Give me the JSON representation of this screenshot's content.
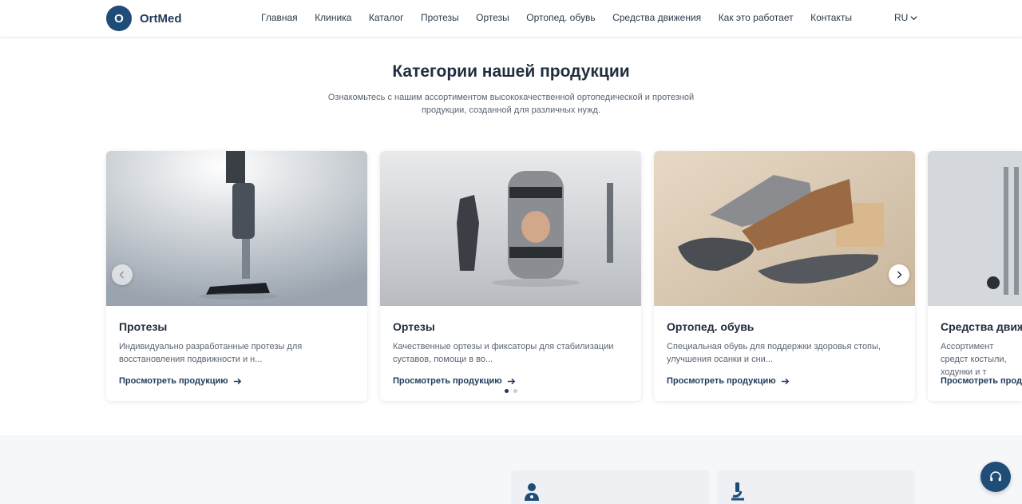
{
  "header": {
    "logo_letter": "O",
    "logo_text": "OrtMed",
    "nav": [
      "Главная",
      "Клиника",
      "Каталог",
      "Протезы",
      "Ортезы",
      "Ортопед. обувь",
      "Средства движения",
      "Как это работает",
      "Контакты"
    ],
    "lang": "RU"
  },
  "section": {
    "title": "Категории нашей продукции",
    "subtitle": "Ознакомьтесь с нашим ассортиментом высококачественной ортопедической и протезной продукции, созданной для различных нужд."
  },
  "cards": [
    {
      "title": "Протезы",
      "desc": "Индивидуально разработанные протезы для восстановления подвижности и н...",
      "link": "Просмотреть продукцию"
    },
    {
      "title": "Ортезы",
      "desc": "Качественные ортезы и фиксаторы для стабилизации суставов, помощи в во...",
      "link": "Просмотреть продукцию"
    },
    {
      "title": "Ортопед. обувь",
      "desc": "Специальная обувь для поддержки здоровья стопы, улучшения осанки и сни...",
      "link": "Просмотреть продукцию"
    },
    {
      "title": "Средства движ",
      "desc": "Ассортимент средст костыли, ходунки и т",
      "link": "Просмотреть прод"
    }
  ],
  "carousel": {
    "dots": 2,
    "active_dot": 0
  },
  "icons": {
    "prev": "chevron-left-icon",
    "next": "chevron-right-icon",
    "arrow": "arrow-right-icon",
    "chat": "headset-icon",
    "doctor": "doctor-icon",
    "microscope": "microscope-icon"
  },
  "colors": {
    "brand": "#1f4d78",
    "text": "#1f2d3d",
    "muted": "#5a6472"
  }
}
